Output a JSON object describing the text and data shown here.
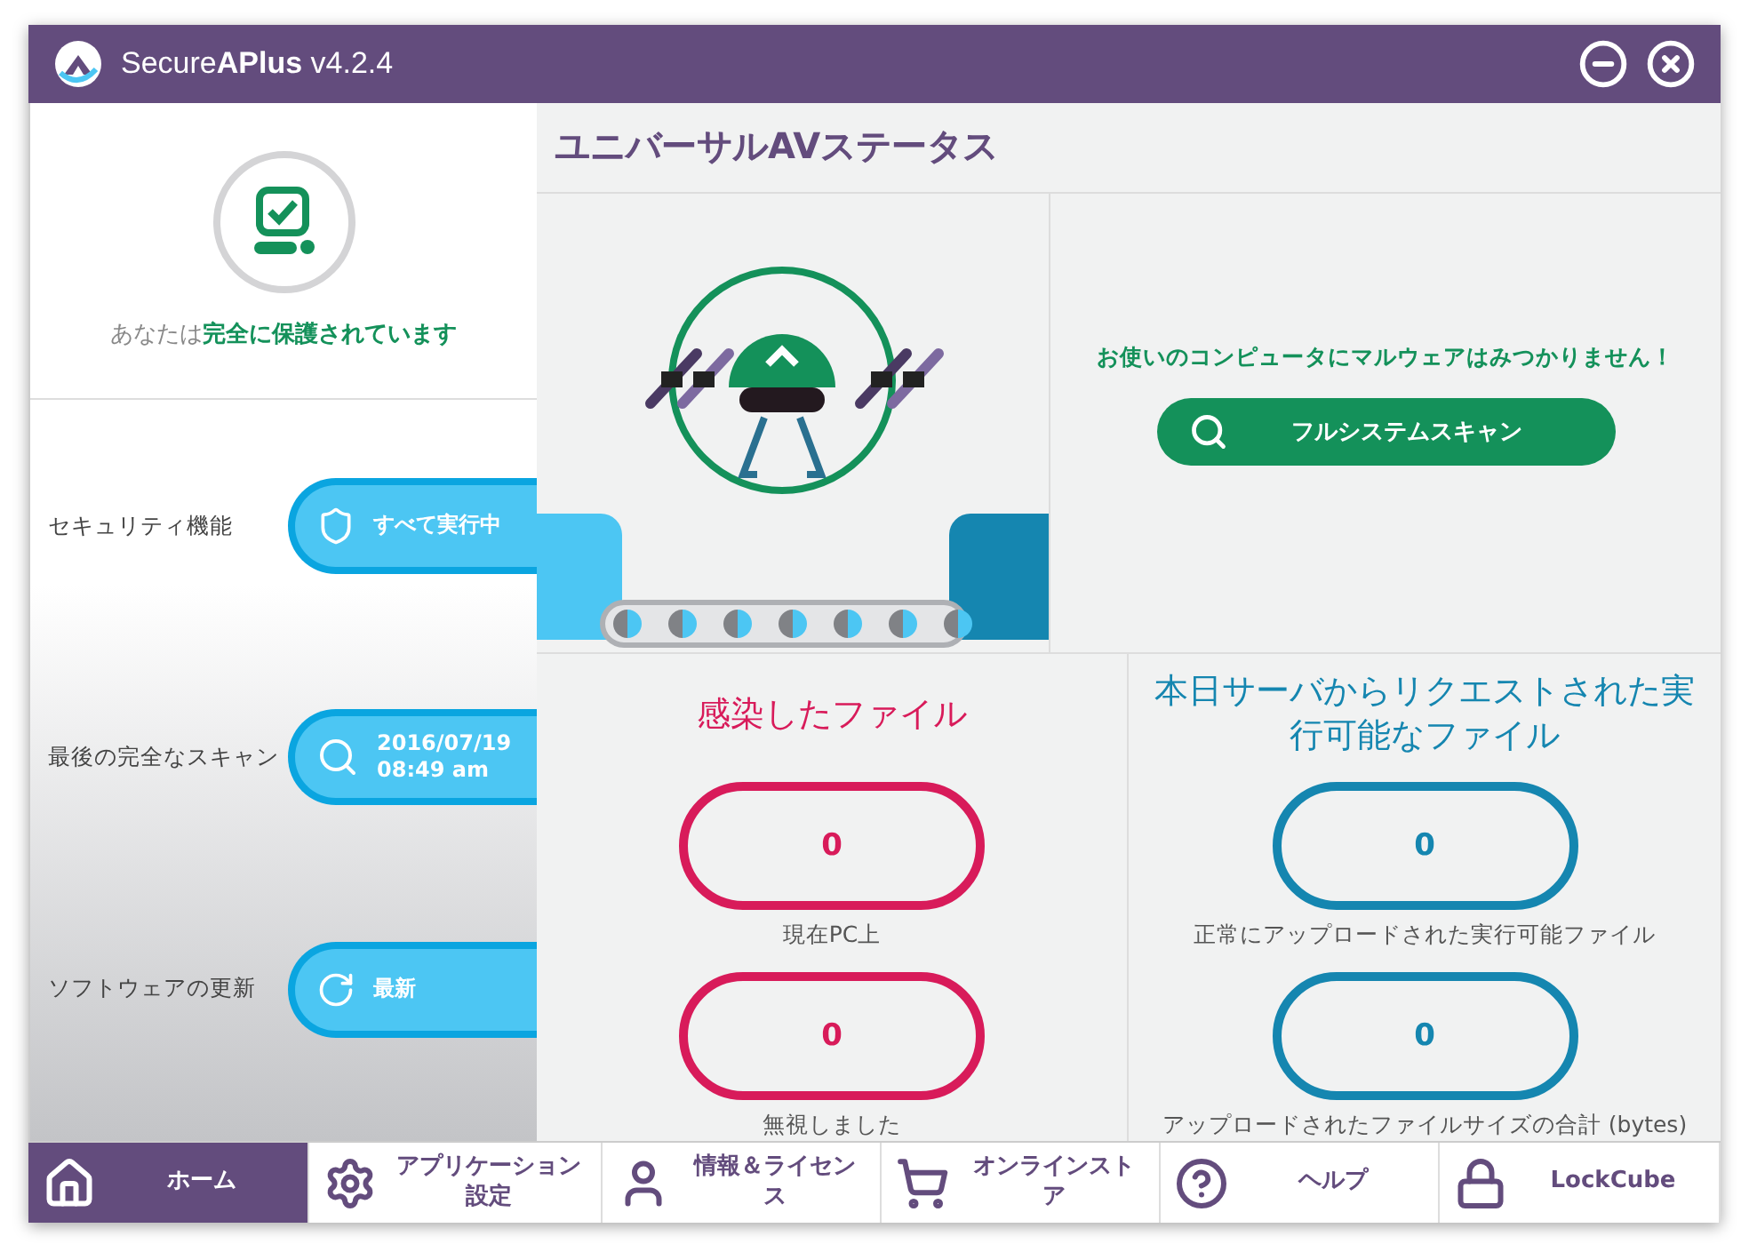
{
  "window": {
    "title": "Secure**APlus** v4.2.4"
  },
  "status": {
    "text": "あなたは**完全に保護されています**"
  },
  "sidebar_items": [
    {
      "label": "セキュリティ機能",
      "kind": "shield",
      "value": "すべて実行中"
    },
    {
      "label": "最後の完全なスキャン",
      "kind": "search",
      "value": "2016/07/19 08:49 am"
    },
    {
      "label": "ソフトウェアの更新",
      "kind": "refresh",
      "value": "最新"
    }
  ],
  "header": "ユニバーサルAVステータス",
  "scan": {
    "message": "お使いのコンピュータにマルウェアはみつかりません！",
    "button": "フルシステムスキャン"
  },
  "sections": [
    {
      "title": "感染したファイル",
      "color": "#d81b5a",
      "counters": [
        {
          "value": "0",
          "caption": "現在PC上"
        },
        {
          "value": "0",
          "caption": "無視しました"
        }
      ]
    },
    {
      "title": "本日サーバからリクエストされた実行可能なファイル",
      "color": "#1586b0",
      "counters": [
        {
          "value": "0",
          "caption": "正常にアップロードされた実行可能ファイル"
        },
        {
          "value": "0",
          "caption": "アップロードされたファイルサイズの合計 (bytes)"
        }
      ]
    }
  ],
  "nav": [
    {
      "label": "ホーム",
      "kind": "home",
      "selected": true
    },
    {
      "label": "アプリケーション設定",
      "kind": "settings",
      "selected": false
    },
    {
      "label": "情報＆ライセンス",
      "kind": "user",
      "selected": false
    },
    {
      "label": "オンラインストア",
      "kind": "cart",
      "selected": false
    },
    {
      "label": "ヘルプ",
      "kind": "help",
      "selected": false
    },
    {
      "label": "LockCube",
      "kind": "lock",
      "selected": false
    }
  ]
}
